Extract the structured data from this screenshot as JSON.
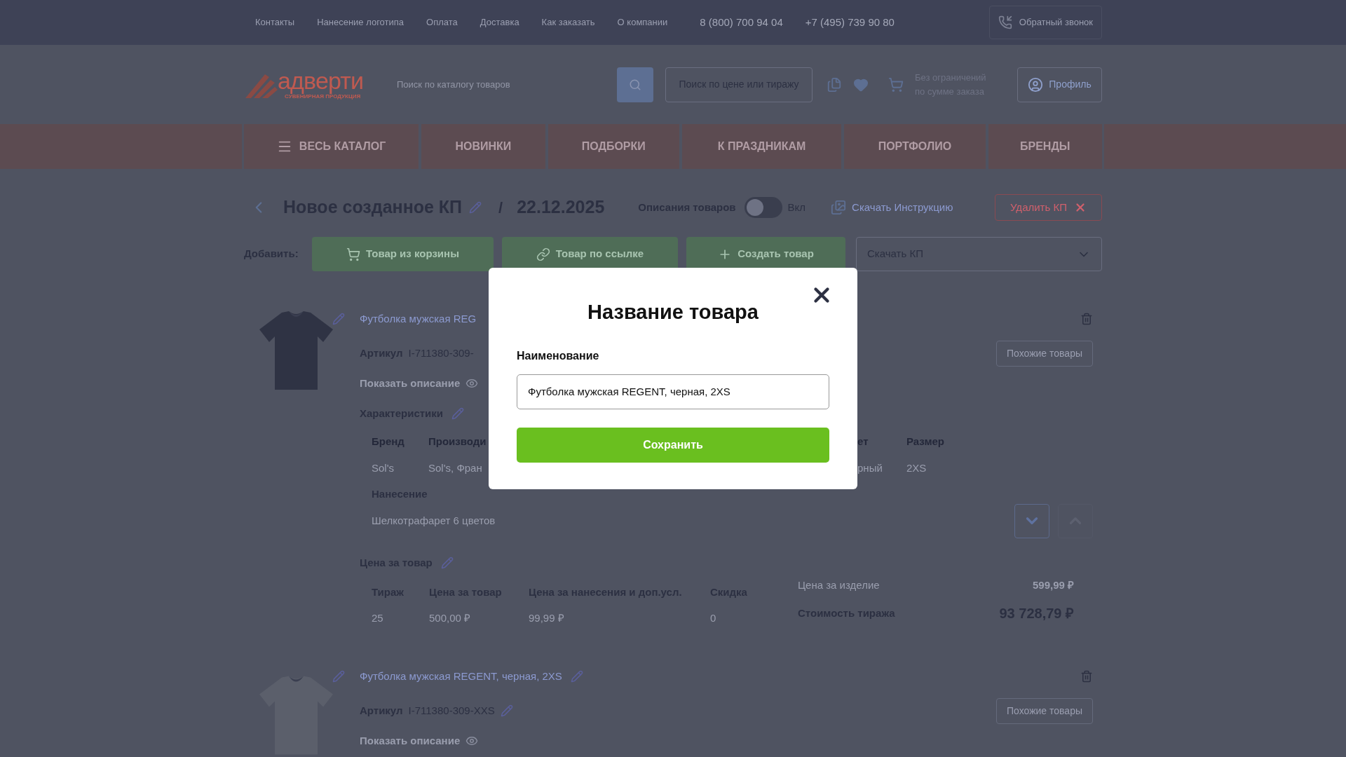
{
  "top_bar": {
    "links": [
      "Контакты",
      "Нанесение логотипа",
      "Оплата",
      "Доставка",
      "Как заказать",
      "О компании"
    ],
    "phones": [
      "8 (800) 700 94 04",
      "+7 (495) 739 90 80"
    ],
    "callback_button": "Обратный звонок"
  },
  "header": {
    "logo": {
      "name": "адверти",
      "tagline": "СУВЕНИРНАЯ ПРОДУКЦИЯ"
    },
    "search": {
      "placeholder": "Поиск по каталогу товаров"
    },
    "price_search_button": "Поиск по цене или тиражу",
    "cart_note": [
      "Без ограничений",
      "по сумме заказа"
    ],
    "profile_button": "Профиль"
  },
  "nav": [
    {
      "label": "ВЕСЬ КАТАЛОГ",
      "kind": "menu"
    },
    {
      "label": "НОВИНКИ",
      "kind": "plain"
    },
    {
      "label": "ПОДБОРКИ",
      "kind": "plain"
    },
    {
      "label": "К ПРАЗДНИКАМ",
      "kind": "plain"
    },
    {
      "label": "ПОРТФОЛИО",
      "kind": "plain"
    },
    {
      "label": "БРЕНДЫ",
      "kind": "plain"
    }
  ],
  "kp": {
    "title": "Новое созданное КП",
    "separator": "/",
    "date": "22.12.2025",
    "descriptions_toggle": {
      "label": "Описания товаров",
      "on": false,
      "state_label": "Вкл"
    },
    "instruction_link": "Скачать Инструкцию",
    "delete_button": "Удалить КП"
  },
  "add_bar": {
    "label": "Добавить:",
    "buttons": [
      {
        "label": "Товар из корзины",
        "kind": "cart"
      },
      {
        "label": "Товар по ссылке",
        "kind": "link"
      },
      {
        "label": "Создать товар",
        "kind": "plus"
      }
    ],
    "download_select": "Скачать КП"
  },
  "products": [
    {
      "image": {
        "kind": "picture"
      },
      "title": "Футболка мужская REG",
      "edit_icons": false,
      "article_label": "Артикул",
      "article": "I-711380-309-",
      "show_description": "Показать описание",
      "similar_button": "Похожие товары",
      "characteristics_title": "Характеристики",
      "specs": [
        {
          "name": "Бренд",
          "value": "Sol's"
        },
        {
          "name": "Производи",
          "value": "Sol's, Фран"
        },
        {
          "name": "ет",
          "value": "рный"
        },
        {
          "name": "Размер",
          "value": "2XS"
        }
      ],
      "print_title": "Нанесение",
      "print_value": "Шелкотрафарет 6 цветов",
      "order_buttons": [
        {
          "kind": "down",
          "disabled": false
        },
        {
          "kind": "up",
          "disabled": true
        }
      ],
      "price_title": "Цена за товар",
      "price_table": {
        "columns": [
          "Тираж",
          "Цена за товар",
          "Цена за нанесения и доп.усл.",
          "Скидка"
        ],
        "rows": [
          [
            "25",
            "500,00 ₽",
            "99,99 ₽",
            "0"
          ]
        ]
      },
      "unit_price_label": "Цена за изделие",
      "unit_price": "599,99 ₽",
      "total_label": "Стоимость тиража",
      "total": "93 728,79 ₽"
    },
    {
      "image": {
        "kind": "picture"
      },
      "title": "Футболка мужская REGENT, черная, 2XS",
      "edit_icons": true,
      "article_label": "Артикул",
      "article": "I-711380-309-XXS",
      "show_description": "Показать описание",
      "similar_button": "Похожие товары"
    }
  ],
  "modal": {
    "title": "Название товара",
    "field_label": "Наименование",
    "value": "Футболка мужская REGENT, черная, 2XS",
    "save_button": "Сохранить"
  }
}
